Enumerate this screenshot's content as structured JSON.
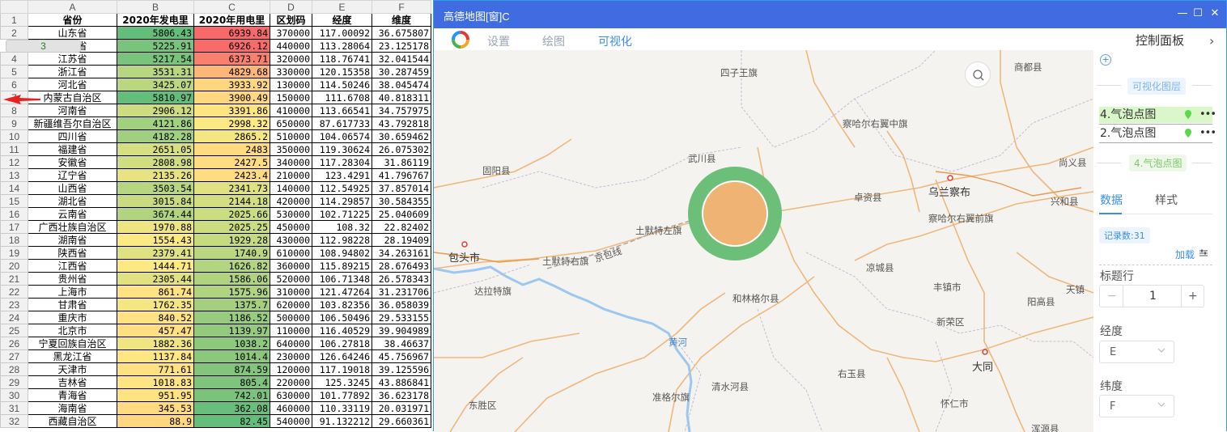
{
  "sheet": {
    "col_letters": [
      "A",
      "B",
      "C",
      "D",
      "E",
      "F"
    ],
    "headers": [
      "省份",
      "2020年发电里",
      "2020年用电里",
      "区划码",
      "经度",
      "维度"
    ],
    "rows": [
      {
        "n": "2",
        "p": "山东省",
        "b": "5806.43",
        "c": "6939.84",
        "d": "370000",
        "e": "117.00092",
        "f": "36.675807",
        "bc": "#63be7b",
        "cc": "#f8696b"
      },
      {
        "n": "3",
        "p": "广东省",
        "b": "5225.91",
        "c": "6926.12",
        "d": "440000",
        "e": "113.28064",
        "f": "23.125178",
        "bc": "#78c47d",
        "cc": "#f86b6b"
      },
      {
        "n": "4",
        "p": "江苏省",
        "b": "5217.54",
        "c": "6373.71",
        "d": "320000",
        "e": "118.76741",
        "f": "32.041544",
        "bc": "#78c47d",
        "cc": "#f97f6f"
      },
      {
        "n": "5",
        "p": "浙江省",
        "b": "3531.31",
        "c": "4829.68",
        "d": "330000",
        "e": "120.15358",
        "f": "30.287459",
        "bc": "#b7d67f",
        "cc": "#fcb679"
      },
      {
        "n": "6",
        "p": "河北省",
        "b": "3425.07",
        "c": "3933.92",
        "d": "130000",
        "e": "114.50246",
        "f": "38.045474",
        "bc": "#bad780",
        "cc": "#fed67f"
      },
      {
        "n": "7",
        "p": "内蒙古自治区",
        "b": "5810.97",
        "c": "3900.49",
        "d": "150000",
        "e": "111.6708",
        "f": "40.818311",
        "bc": "#63be7b",
        "cc": "#fed780"
      },
      {
        "n": "8",
        "p": "河南省",
        "b": "2906.12",
        "c": "3391.86",
        "d": "410000",
        "e": "113.66541",
        "f": "34.757975",
        "bc": "#cddc81",
        "cc": "#fee582"
      },
      {
        "n": "9",
        "p": "新疆维吾尔自治区",
        "b": "4121.86",
        "c": "2998.32",
        "d": "650000",
        "e": "87.617733",
        "f": "43.792818",
        "bc": "#a1d07f",
        "cc": "#fbe983"
      },
      {
        "n": "10",
        "p": "四川省",
        "b": "4182.28",
        "c": "2865.2",
        "d": "510000",
        "e": "104.06574",
        "f": "30.659462",
        "bc": "#9fcf7f",
        "cc": "#f4e783"
      },
      {
        "n": "11",
        "p": "福建省",
        "b": "2651.05",
        "c": "2483",
        "d": "350000",
        "e": "119.30624",
        "f": "26.075302",
        "bc": "#d6df81",
        "cc": "#fedb81"
      },
      {
        "n": "12",
        "p": "安徽省",
        "b": "2808.98",
        "c": "2427.5",
        "d": "340000",
        "e": "117.28304",
        "f": "31.86119",
        "bc": "#d0dd81",
        "cc": "#fedc81"
      },
      {
        "n": "13",
        "p": "辽宁省",
        "b": "2135.26",
        "c": "2423.4",
        "d": "210000",
        "e": "123.4291",
        "f": "41.796767",
        "bc": "#e8e382",
        "cc": "#fedc81"
      },
      {
        "n": "14",
        "p": "山西省",
        "b": "3503.54",
        "c": "2341.73",
        "d": "140000",
        "e": "112.54925",
        "f": "37.857014",
        "bc": "#b8d67f",
        "cc": "#dfe182"
      },
      {
        "n": "15",
        "p": "湖北省",
        "b": "3015.84",
        "c": "2144.18",
        "d": "420000",
        "e": "114.29857",
        "f": "30.584355",
        "bc": "#c9da80",
        "cc": "#d3de82"
      },
      {
        "n": "16",
        "p": "云南省",
        "b": "3674.44",
        "c": "2025.66",
        "d": "530000",
        "e": "102.71225",
        "f": "25.040609",
        "bc": "#b2d47f",
        "cc": "#ccdc81"
      },
      {
        "n": "17",
        "p": "广西壮族自治区",
        "b": "1970.88",
        "c": "2025.25",
        "d": "450000",
        "e": "108.32",
        "f": "22.82402",
        "bc": "#ede582",
        "cc": "#ccdc81"
      },
      {
        "n": "18",
        "p": "湖南省",
        "b": "1554.43",
        "c": "1929.28",
        "d": "430000",
        "e": "112.98228",
        "f": "28.19409",
        "bc": "#fbe983",
        "cc": "#c6da80"
      },
      {
        "n": "19",
        "p": "陕西省",
        "b": "2379.41",
        "c": "1740.9",
        "d": "610000",
        "e": "108.94802",
        "f": "34.263161",
        "bc": "#dfe182",
        "cc": "#bad680"
      },
      {
        "n": "20",
        "p": "江西省",
        "b": "1444.71",
        "c": "1626.82",
        "d": "360000",
        "e": "115.89215",
        "f": "28.676493",
        "bc": "#fde983",
        "cc": "#b3d480"
      },
      {
        "n": "21",
        "p": "贵州省",
        "b": "2305.44",
        "c": "1586.06",
        "d": "520000",
        "e": "106.71348",
        "f": "26.578343",
        "bc": "#e2e182",
        "cc": "#b1d37f"
      },
      {
        "n": "22",
        "p": "上海市",
        "b": "861.74",
        "c": "1575.96",
        "d": "310000",
        "e": "121.47264",
        "f": "31.231706",
        "bc": "#fee283",
        "cc": "#b0d37f"
      },
      {
        "n": "23",
        "p": "甘肃省",
        "b": "1762.35",
        "c": "1375.7",
        "d": "620000",
        "e": "103.82356",
        "f": "36.058039",
        "bc": "#f4e783",
        "cc": "#a3cf7f"
      },
      {
        "n": "24",
        "p": "重庆市",
        "b": "840.52",
        "c": "1186.52",
        "d": "500000",
        "e": "106.50496",
        "f": "29.533155",
        "bc": "#fee283",
        "cc": "#97cb7e"
      },
      {
        "n": "25",
        "p": "北京市",
        "b": "457.47",
        "c": "1139.97",
        "d": "110000",
        "e": "116.40529",
        "f": "39.904989",
        "bc": "#fedf82",
        "cc": "#94ca7e"
      },
      {
        "n": "26",
        "p": "宁夏回族自治区",
        "b": "1882.36",
        "c": "1038.2",
        "d": "640000",
        "e": "106.27818",
        "f": "38.46637",
        "bc": "#efe582",
        "cc": "#8dc87d"
      },
      {
        "n": "27",
        "p": "黑龙江省",
        "b": "1137.84",
        "c": "1014.4",
        "d": "230000",
        "e": "126.64246",
        "f": "45.756967",
        "bc": "#fee683",
        "cc": "#8cc77d"
      },
      {
        "n": "28",
        "p": "天津市",
        "b": "771.61",
        "c": "874.59",
        "d": "120000",
        "e": "117.19018",
        "f": "39.125596",
        "bc": "#fee182",
        "cc": "#83c57d"
      },
      {
        "n": "29",
        "p": "吉林省",
        "b": "1018.83",
        "c": "805.4",
        "d": "220000",
        "e": "125.3245",
        "f": "43.886841",
        "bc": "#fee483",
        "cc": "#7ec47c"
      },
      {
        "n": "30",
        "p": "青海省",
        "b": "951.95",
        "c": "742.01",
        "d": "630000",
        "e": "101.77892",
        "f": "36.623178",
        "bc": "#fee382",
        "cc": "#7ac37c"
      },
      {
        "n": "31",
        "p": "海南省",
        "b": "345.53",
        "c": "362.08",
        "d": "460000",
        "e": "110.33119",
        "f": "20.031971",
        "bc": "#feda81",
        "cc": "#67bf7b"
      },
      {
        "n": "32",
        "p": "西藏自治区",
        "b": "88.9",
        "c": "82.45",
        "d": "540000",
        "e": "91.132212",
        "f": "29.660361",
        "bc": "#fed780",
        "cc": "#63be7b"
      }
    ]
  },
  "window": {
    "title": "高德地图[窗]C",
    "menu": [
      "设置",
      "绘图",
      "可视化"
    ]
  },
  "map": {
    "labels": [
      {
        "t": "四子王旗",
        "k": ""
      },
      {
        "t": "商都县",
        "k": ""
      },
      {
        "t": "察哈尔右翼中旗",
        "k": ""
      },
      {
        "t": "武川县",
        "k": ""
      },
      {
        "t": "固阳县",
        "k": ""
      },
      {
        "t": "尚义县",
        "k": ""
      },
      {
        "t": "卓资县",
        "k": ""
      },
      {
        "t": "乌兰察布",
        "k": "city"
      },
      {
        "t": "兴和县",
        "k": ""
      },
      {
        "t": "察哈尔右翼前旗",
        "k": ""
      },
      {
        "t": "土默特左旗",
        "k": ""
      },
      {
        "t": "包头市",
        "k": "city"
      },
      {
        "t": "土默特右旗",
        "k": ""
      },
      {
        "t": "京包线",
        "k": ""
      },
      {
        "t": "达拉特旗",
        "k": ""
      },
      {
        "t": "凉城县",
        "k": ""
      },
      {
        "t": "丰镇市",
        "k": ""
      },
      {
        "t": "天镇",
        "k": ""
      },
      {
        "t": "和林格尔县",
        "k": ""
      },
      {
        "t": "阳高县",
        "k": ""
      },
      {
        "t": "黄河",
        "k": "river"
      },
      {
        "t": "新荣区",
        "k": ""
      },
      {
        "t": "大同",
        "k": "city"
      },
      {
        "t": "右玉县",
        "k": ""
      },
      {
        "t": "清水河县",
        "k": ""
      },
      {
        "t": "准格尔旗",
        "k": ""
      },
      {
        "t": "东胜区",
        "k": ""
      },
      {
        "t": "怀仁市",
        "k": ""
      },
      {
        "t": "浑源县",
        "k": ""
      }
    ]
  },
  "panel": {
    "title": "控制面板",
    "viz_layers_tag": "可视化图层",
    "layers": [
      "4.气泡点图",
      "2.气泡点图"
    ],
    "active_layer_tag": "4.气泡点图",
    "tabs": [
      "数据",
      "样式"
    ],
    "record_count": "记录数:31",
    "load_label": "加载",
    "header_row_label": "标题行",
    "header_row_minus": "−",
    "header_row_value": "1",
    "header_row_plus": "+",
    "lng_label": "经度",
    "lng_value": "E",
    "lat_label": "纬度",
    "lat_value": "F"
  },
  "colors": {
    "titlebar": "#3f6ce0",
    "accent": "#3a8ee6",
    "bubble_outer": "#6cbf78",
    "bubble_inner": "#efb474",
    "layer_highlight": "#d9f7c8"
  }
}
